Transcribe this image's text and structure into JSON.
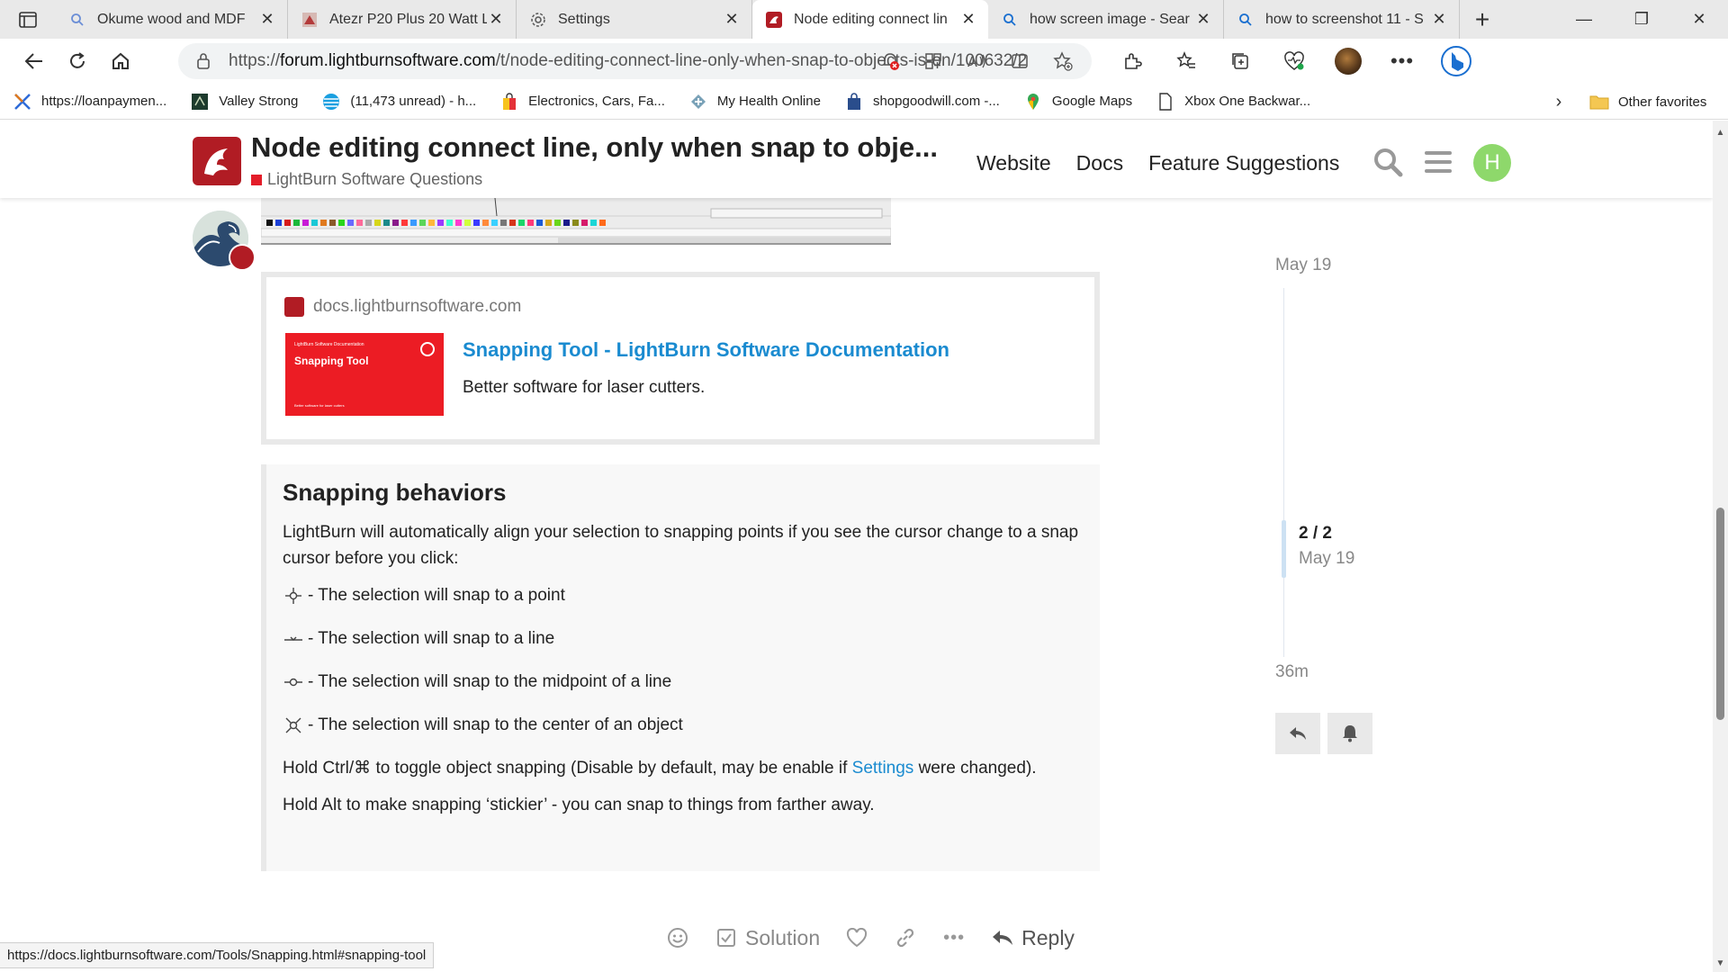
{
  "browser": {
    "tabs": [
      {
        "title": "Okume wood and MDF",
        "icon": "search-icon",
        "active": false
      },
      {
        "title": "Atezr P20 Plus 20 Watt L",
        "icon": "product-image-icon",
        "active": false
      },
      {
        "title": "Settings",
        "icon": "gear-icon",
        "active": false
      },
      {
        "title": "Node editing connect lin",
        "icon": "lightburn-icon",
        "active": true
      },
      {
        "title": "how screen image - Sear",
        "icon": "search-icon",
        "active": false
      },
      {
        "title": "how to screenshot 11 - S",
        "icon": "search-icon",
        "active": false
      }
    ],
    "address": {
      "prefix": "https://",
      "domain": "forum.lightburnsoftware.com",
      "path": "/t/node-editing-connect-line-only-when-snap-to-objects-is-on/100632/2"
    },
    "favorites": [
      {
        "label": "https://loanpaymen...",
        "icon": "cross-icon"
      },
      {
        "label": "Valley Strong",
        "icon": "bank-icon"
      },
      {
        "label": "(11,473 unread) - h...",
        "icon": "att-globe-icon"
      },
      {
        "label": "Electronics, Cars, Fa...",
        "icon": "shopping-bag-icon"
      },
      {
        "label": "My Health Online",
        "icon": "health-icon"
      },
      {
        "label": "shopgoodwill.com -...",
        "icon": "shopping-bag-icon"
      },
      {
        "label": "Google Maps",
        "icon": "map-pin-icon"
      },
      {
        "label": "Xbox One Backwar...",
        "icon": "page-icon"
      }
    ],
    "other_favorites": "Other favorites",
    "status_url": "https://docs.lightburnsoftware.com/Tools/Snapping.html#snapping-tool"
  },
  "header": {
    "topic_title": "Node editing connect line, only when snap to obje...",
    "category": "LightBurn Software Questions",
    "nav": [
      "Website",
      "Docs",
      "Feature Suggestions"
    ],
    "avatar_letter": "H"
  },
  "onebox": {
    "source": "docs.lightburnsoftware.com",
    "thumb_small": "LightBurn Software Documentation",
    "thumb_title": "Snapping Tool",
    "thumb_footer": "Better software for laser cutters",
    "title": "Snapping Tool - LightBurn Software Documentation",
    "description": "Better software for laser cutters."
  },
  "quote": {
    "heading": "Snapping behaviors",
    "intro": "LightBurn will automatically align your selection to snapping points if you see the cursor change to a snap cursor before you click:",
    "items": [
      "- The selection will snap to a point",
      "- The selection will snap to a line",
      "- The selection will snap to the midpoint of a line",
      "- The selection will snap to the center of an object"
    ],
    "ctrl_pre": "Hold Ctrl/⌘ to toggle object snapping (Disable by default, may be enable if ",
    "ctrl_link": "Settings",
    "ctrl_post": " were changed).",
    "alt": "Hold Alt to make snapping ‘stickier’ - you can snap to things from farther away."
  },
  "timeline": {
    "date_top": "May 19",
    "count": "2 / 2",
    "date_mid": "May 19",
    "ago": "36m"
  },
  "post_controls": {
    "solution": "Solution",
    "reply": "Reply"
  },
  "colors": {
    "brand": "#b11c24",
    "link": "#1a8bd0",
    "avatar": "#8ed86b"
  }
}
